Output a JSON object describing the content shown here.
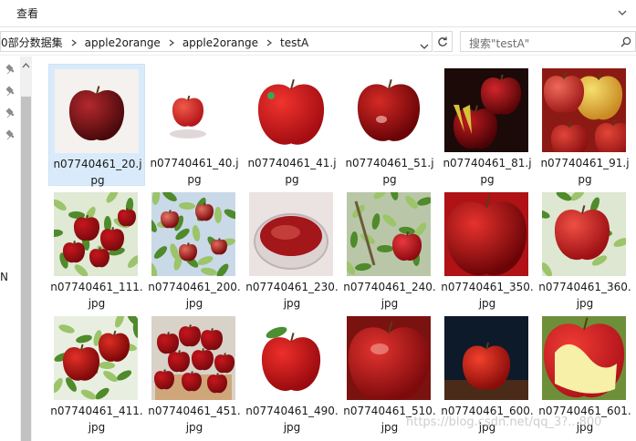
{
  "ribbon": {
    "tab_label": "查看"
  },
  "address": {
    "crumbs": [
      "0部分数据集",
      "apple2orange",
      "apple2orange",
      "testA"
    ]
  },
  "search": {
    "placeholder": "搜索\"testA\""
  },
  "nav": {
    "partial_label": "N"
  },
  "files": [
    {
      "line1": "n07740461_20.j",
      "line2": "pg",
      "selected": true
    },
    {
      "line1": "n07740461_40.j",
      "line2": "pg"
    },
    {
      "line1": "n07740461_41.j",
      "line2": "pg"
    },
    {
      "line1": "n07740461_51.j",
      "line2": "pg"
    },
    {
      "line1": "n07740461_81.j",
      "line2": "pg"
    },
    {
      "line1": "n07740461_91.j",
      "line2": "pg"
    },
    {
      "line1": "n07740461_111.",
      "line2": "jpg"
    },
    {
      "line1": "n07740461_200.",
      "line2": "jpg"
    },
    {
      "line1": "n07740461_230.",
      "line2": "jpg"
    },
    {
      "line1": "n07740461_240.",
      "line2": "jpg"
    },
    {
      "line1": "n07740461_350.",
      "line2": "jpg"
    },
    {
      "line1": "n07740461_360.",
      "line2": "jpg"
    },
    {
      "line1": "n07740461_411.",
      "line2": "jpg"
    },
    {
      "line1": "n07740461_451.",
      "line2": "jpg"
    },
    {
      "line1": "n07740461_490.",
      "line2": "jpg"
    },
    {
      "line1": "n07740461_510.",
      "line2": "jpg"
    },
    {
      "line1": "n07740461_600.",
      "line2": "jpg"
    },
    {
      "line1": "n07740461_601.",
      "line2": "jpg"
    }
  ],
  "watermark": "https://blog.csdn.net/qq_3?...800",
  "colors": {
    "selection": "#d9ebfb",
    "apple_red": "#c8161d"
  }
}
